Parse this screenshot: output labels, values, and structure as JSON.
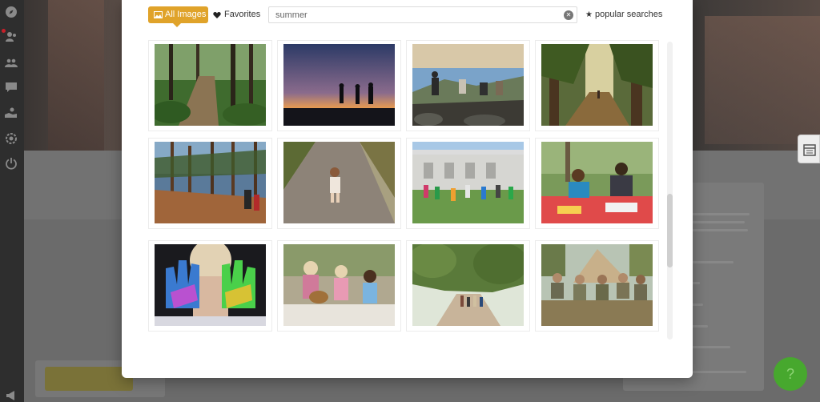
{
  "sidebar": {
    "icons": [
      "compass-icon",
      "users-icon",
      "group-icon",
      "chat-icon",
      "handshake-icon",
      "settings-icon",
      "power-icon"
    ]
  },
  "modal": {
    "tabs": {
      "all_images": "All Images",
      "favorites": "Favorites"
    },
    "search": {
      "value": "summer"
    },
    "popular_searches": "popular searches",
    "images": [
      {
        "subject": "forest-path"
      },
      {
        "subject": "sunset-silhouettes"
      },
      {
        "subject": "hikers-on-rocks"
      },
      {
        "subject": "sunlit-forest"
      },
      {
        "subject": "pine-forest-hike"
      },
      {
        "subject": "child-on-road"
      },
      {
        "subject": "kids-playing-tug"
      },
      {
        "subject": "kids-crafting-table"
      },
      {
        "subject": "painted-hands"
      },
      {
        "subject": "girls-with-ukulele"
      },
      {
        "subject": "family-walk-trees"
      },
      {
        "subject": "campers-with-tent"
      }
    ]
  },
  "colors": {
    "accent": "#e0a32a",
    "help_button": "#47a82e"
  }
}
